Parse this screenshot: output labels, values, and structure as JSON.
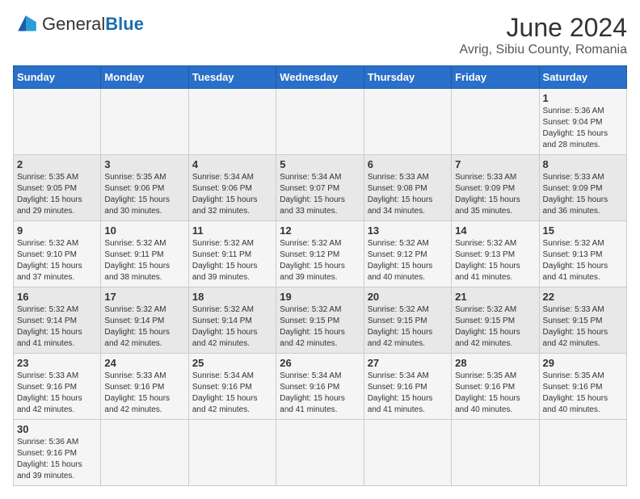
{
  "logo": {
    "text_general": "General",
    "text_blue": "Blue"
  },
  "title": "June 2024",
  "location": "Avrig, Sibiu County, Romania",
  "days_of_week": [
    "Sunday",
    "Monday",
    "Tuesday",
    "Wednesday",
    "Thursday",
    "Friday",
    "Saturday"
  ],
  "weeks": [
    [
      {
        "day": "",
        "info": ""
      },
      {
        "day": "",
        "info": ""
      },
      {
        "day": "",
        "info": ""
      },
      {
        "day": "",
        "info": ""
      },
      {
        "day": "",
        "info": ""
      },
      {
        "day": "",
        "info": ""
      },
      {
        "day": "1",
        "info": "Sunrise: 5:36 AM\nSunset: 9:04 PM\nDaylight: 15 hours\nand 28 minutes."
      }
    ],
    [
      {
        "day": "2",
        "info": "Sunrise: 5:35 AM\nSunset: 9:05 PM\nDaylight: 15 hours\nand 29 minutes."
      },
      {
        "day": "3",
        "info": "Sunrise: 5:35 AM\nSunset: 9:06 PM\nDaylight: 15 hours\nand 30 minutes."
      },
      {
        "day": "4",
        "info": "Sunrise: 5:34 AM\nSunset: 9:06 PM\nDaylight: 15 hours\nand 32 minutes."
      },
      {
        "day": "5",
        "info": "Sunrise: 5:34 AM\nSunset: 9:07 PM\nDaylight: 15 hours\nand 33 minutes."
      },
      {
        "day": "6",
        "info": "Sunrise: 5:33 AM\nSunset: 9:08 PM\nDaylight: 15 hours\nand 34 minutes."
      },
      {
        "day": "7",
        "info": "Sunrise: 5:33 AM\nSunset: 9:09 PM\nDaylight: 15 hours\nand 35 minutes."
      },
      {
        "day": "8",
        "info": "Sunrise: 5:33 AM\nSunset: 9:09 PM\nDaylight: 15 hours\nand 36 minutes."
      }
    ],
    [
      {
        "day": "9",
        "info": "Sunrise: 5:32 AM\nSunset: 9:10 PM\nDaylight: 15 hours\nand 37 minutes."
      },
      {
        "day": "10",
        "info": "Sunrise: 5:32 AM\nSunset: 9:11 PM\nDaylight: 15 hours\nand 38 minutes."
      },
      {
        "day": "11",
        "info": "Sunrise: 5:32 AM\nSunset: 9:11 PM\nDaylight: 15 hours\nand 39 minutes."
      },
      {
        "day": "12",
        "info": "Sunrise: 5:32 AM\nSunset: 9:12 PM\nDaylight: 15 hours\nand 39 minutes."
      },
      {
        "day": "13",
        "info": "Sunrise: 5:32 AM\nSunset: 9:12 PM\nDaylight: 15 hours\nand 40 minutes."
      },
      {
        "day": "14",
        "info": "Sunrise: 5:32 AM\nSunset: 9:13 PM\nDaylight: 15 hours\nand 41 minutes."
      },
      {
        "day": "15",
        "info": "Sunrise: 5:32 AM\nSunset: 9:13 PM\nDaylight: 15 hours\nand 41 minutes."
      }
    ],
    [
      {
        "day": "16",
        "info": "Sunrise: 5:32 AM\nSunset: 9:14 PM\nDaylight: 15 hours\nand 41 minutes."
      },
      {
        "day": "17",
        "info": "Sunrise: 5:32 AM\nSunset: 9:14 PM\nDaylight: 15 hours\nand 42 minutes."
      },
      {
        "day": "18",
        "info": "Sunrise: 5:32 AM\nSunset: 9:14 PM\nDaylight: 15 hours\nand 42 minutes."
      },
      {
        "day": "19",
        "info": "Sunrise: 5:32 AM\nSunset: 9:15 PM\nDaylight: 15 hours\nand 42 minutes."
      },
      {
        "day": "20",
        "info": "Sunrise: 5:32 AM\nSunset: 9:15 PM\nDaylight: 15 hours\nand 42 minutes."
      },
      {
        "day": "21",
        "info": "Sunrise: 5:32 AM\nSunset: 9:15 PM\nDaylight: 15 hours\nand 42 minutes."
      },
      {
        "day": "22",
        "info": "Sunrise: 5:33 AM\nSunset: 9:15 PM\nDaylight: 15 hours\nand 42 minutes."
      }
    ],
    [
      {
        "day": "23",
        "info": "Sunrise: 5:33 AM\nSunset: 9:16 PM\nDaylight: 15 hours\nand 42 minutes."
      },
      {
        "day": "24",
        "info": "Sunrise: 5:33 AM\nSunset: 9:16 PM\nDaylight: 15 hours\nand 42 minutes."
      },
      {
        "day": "25",
        "info": "Sunrise: 5:34 AM\nSunset: 9:16 PM\nDaylight: 15 hours\nand 42 minutes."
      },
      {
        "day": "26",
        "info": "Sunrise: 5:34 AM\nSunset: 9:16 PM\nDaylight: 15 hours\nand 41 minutes."
      },
      {
        "day": "27",
        "info": "Sunrise: 5:34 AM\nSunset: 9:16 PM\nDaylight: 15 hours\nand 41 minutes."
      },
      {
        "day": "28",
        "info": "Sunrise: 5:35 AM\nSunset: 9:16 PM\nDaylight: 15 hours\nand 40 minutes."
      },
      {
        "day": "29",
        "info": "Sunrise: 5:35 AM\nSunset: 9:16 PM\nDaylight: 15 hours\nand 40 minutes."
      }
    ],
    [
      {
        "day": "30",
        "info": "Sunrise: 5:36 AM\nSunset: 9:16 PM\nDaylight: 15 hours\nand 39 minutes."
      },
      {
        "day": "",
        "info": ""
      },
      {
        "day": "",
        "info": ""
      },
      {
        "day": "",
        "info": ""
      },
      {
        "day": "",
        "info": ""
      },
      {
        "day": "",
        "info": ""
      },
      {
        "day": "",
        "info": ""
      }
    ]
  ]
}
